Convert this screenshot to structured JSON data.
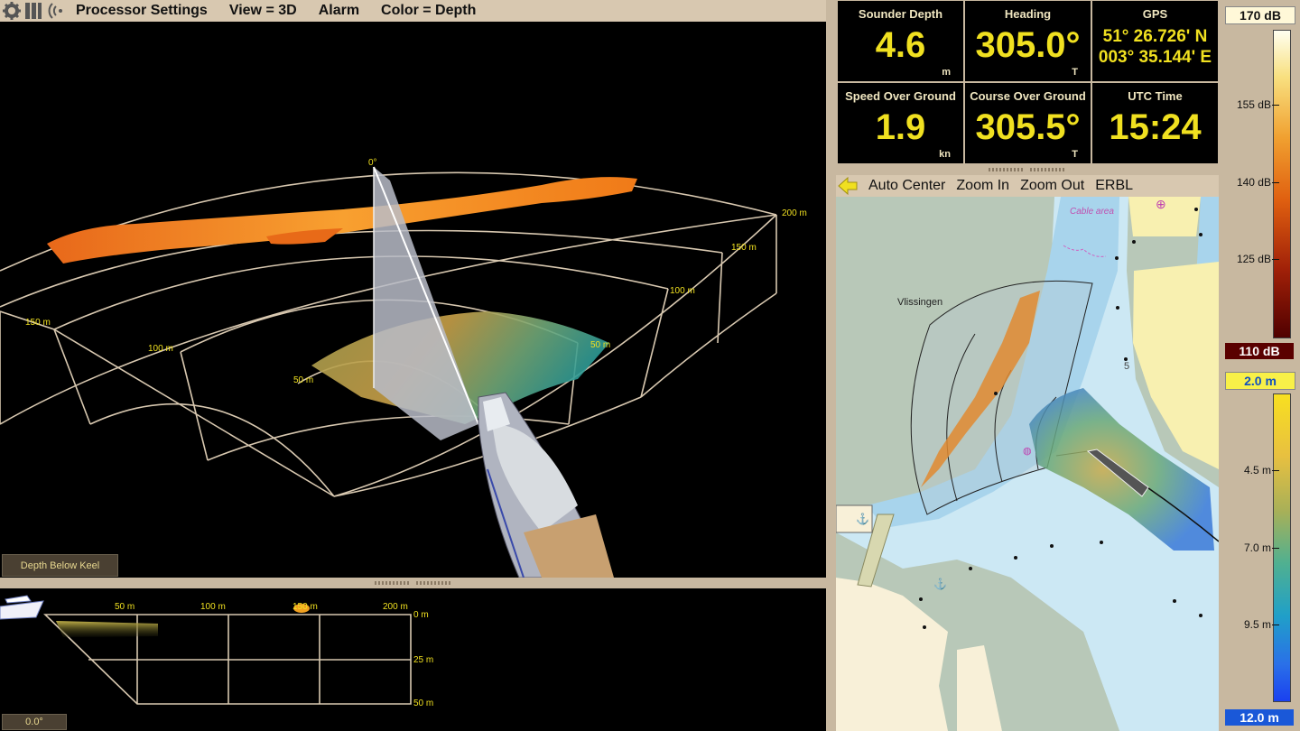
{
  "menu": {
    "items": [
      "Processor Settings",
      "View = 3D",
      "Alarm",
      "Color = Depth"
    ]
  },
  "view3d": {
    "angle_label": "0°",
    "range_labels": [
      "200 m",
      "150 m",
      "100 m",
      "150 m",
      "100 m",
      "50 m",
      "50 m"
    ],
    "depth_button": "Depth Below Keel"
  },
  "side_view": {
    "range_labels": [
      "50 m",
      "100 m",
      "150 m",
      "200 m"
    ],
    "depth_labels": [
      "0 m",
      "25 m",
      "50 m"
    ],
    "angle_value": "0.0°"
  },
  "instruments": [
    {
      "label": "Sounder Depth",
      "value": "4.6",
      "unit": "m"
    },
    {
      "label": "Heading",
      "value": "305.0°",
      "unit": "T"
    },
    {
      "label": "GPS",
      "value_lines": [
        "51° 26.726' N",
        "003° 35.144' E"
      ],
      "unit": ""
    },
    {
      "label": "Speed Over Ground",
      "value": "1.9",
      "unit": "kn"
    },
    {
      "label": "Course Over Ground",
      "value": "305.5°",
      "unit": "T"
    },
    {
      "label": "UTC Time",
      "value": "15:24",
      "unit": ""
    }
  ],
  "map_toolbar": {
    "items": [
      "Auto Center",
      "Zoom In",
      "Zoom Out",
      "ERBL"
    ]
  },
  "map": {
    "place_label": "Vlissingen",
    "cable_label": "Cable area",
    "depth_mark": "5"
  },
  "intensity_bar": {
    "top_value": "170 dB",
    "bottom_value": "110 dB",
    "ticks": [
      "155 dB",
      "140 dB",
      "125 dB"
    ]
  },
  "depth_bar": {
    "top_value": "2.0 m",
    "bottom_value": "12.0 m",
    "ticks": [
      "4.5 m",
      "7.0 m",
      "9.5 m"
    ]
  },
  "colors": {
    "value_yellow": "#f0e020",
    "panel_tan": "#c8b8a0",
    "sonar_orange": "#f07a18"
  }
}
